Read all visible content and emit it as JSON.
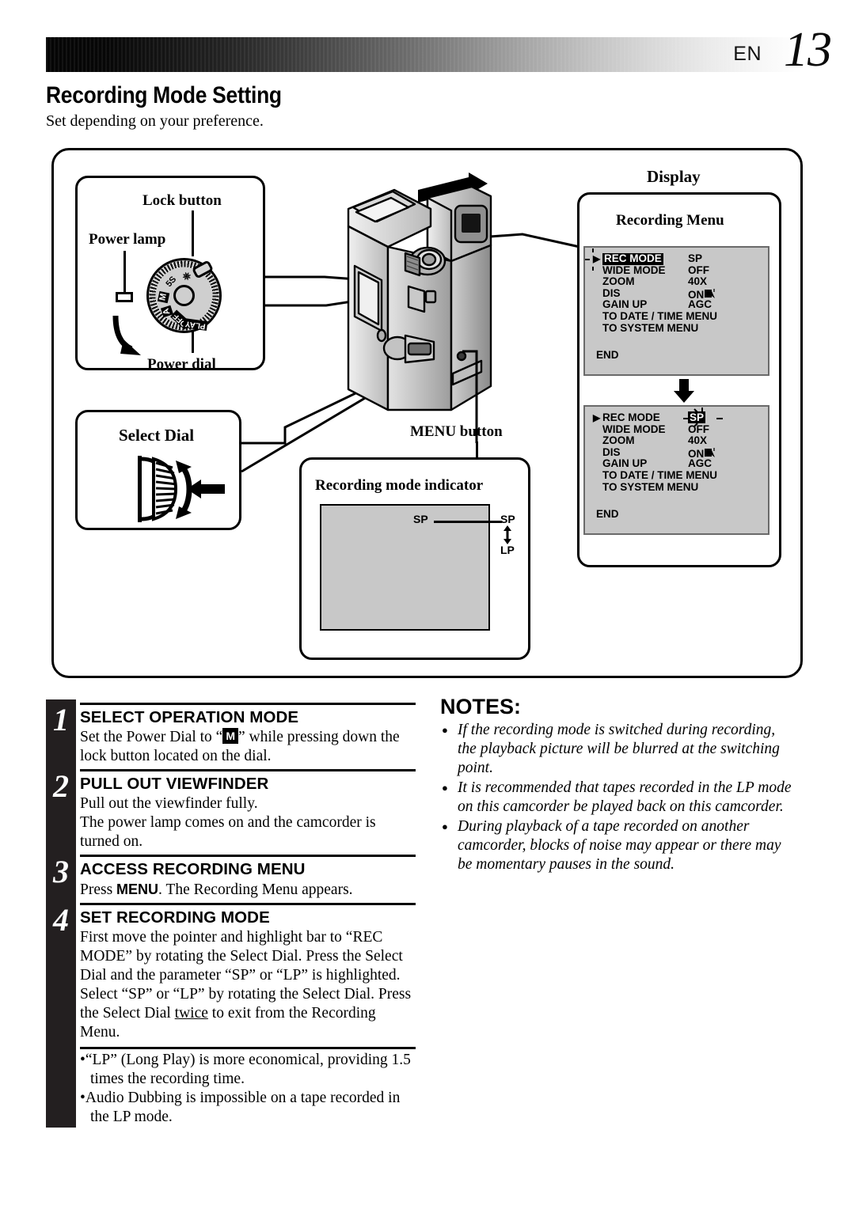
{
  "header": {
    "lang": "EN",
    "page_number": "13"
  },
  "title": "Recording Mode Setting",
  "subtitle": "Set depending on your preference.",
  "diagram": {
    "power_dial_panel": {
      "lock_button_label": "Lock button",
      "power_lamp_label": "Power lamp",
      "power_dial_label": "Power dial",
      "dial_marks": [
        "5S",
        "M",
        "A",
        "OFF",
        "PLAY"
      ]
    },
    "select_dial_panel": {
      "label": "Select Dial"
    },
    "menu_button_label": "MENU button",
    "rec_indicator_panel": {
      "title": "Recording mode indicator",
      "inside_label": "SP",
      "outside_top_label": "SP",
      "outside_bottom_label": "LP"
    },
    "display_panel": {
      "display_label": "Display",
      "recording_menu_label": "Recording Menu",
      "menu_screen_1": {
        "pointer_row": 0,
        "highlight": "name",
        "rows": [
          {
            "name": "REC MODE",
            "value": "SP"
          },
          {
            "name": "WIDE MODE",
            "value": "OFF"
          },
          {
            "name": "ZOOM",
            "value": "40X"
          },
          {
            "name": "DIS",
            "value": "ON"
          },
          {
            "name": "GAIN UP",
            "value": "AGC"
          },
          {
            "name": "TO DATE / TIME MENU",
            "value": ""
          },
          {
            "name": "TO SYSTEM MENU",
            "value": ""
          }
        ],
        "end_label": "END"
      },
      "menu_screen_2": {
        "pointer_row": 0,
        "highlight": "value",
        "rows": [
          {
            "name": "REC MODE",
            "value": "SP"
          },
          {
            "name": "WIDE MODE",
            "value": "OFF"
          },
          {
            "name": "ZOOM",
            "value": "40X"
          },
          {
            "name": "DIS",
            "value": "ON"
          },
          {
            "name": "GAIN UP",
            "value": "AGC"
          },
          {
            "name": "TO DATE / TIME MENU",
            "value": ""
          },
          {
            "name": "TO SYSTEM MENU",
            "value": ""
          }
        ],
        "end_label": "END"
      }
    }
  },
  "steps": [
    {
      "number": "1",
      "heading": "SELECT OPERATION MODE",
      "body_pre": "Set the Power Dial to “",
      "body_key": "M",
      "body_post": "” while pressing down the lock button located on the dial."
    },
    {
      "number": "2",
      "heading": "PULL OUT VIEWFINDER",
      "body": "Pull out the viewfinder fully.\nThe power lamp comes on and the camcorder is turned on."
    },
    {
      "number": "3",
      "heading": "ACCESS RECORDING MENU",
      "body_pre": "Press ",
      "body_key": "MENU",
      "body_post": ". The Recording Menu appears."
    },
    {
      "number": "4",
      "heading": "SET RECORDING MODE",
      "body_pre": "First move the pointer and highlight bar to “REC MODE” by rotating the Select Dial. Press the Select Dial and the parameter “SP” or “LP” is highlighted. Select “SP” or “LP” by rotating the Select Dial. Press the Select Dial ",
      "body_key": "twice",
      "body_post": " to exit from the Recording Menu."
    }
  ],
  "step_bullets": [
    "“LP” (Long Play) is more economical, providing 1.5 times the recording time.",
    "Audio Dubbing is impossible on a tape recorded in the LP mode."
  ],
  "notes": {
    "title": "NOTES:",
    "items": [
      "If the recording mode is switched during recording, the playback picture will be blurred at the switching point.",
      "It is recommended that tapes recorded in the LP mode on this camcorder be played back on this camcorder.",
      "During playback of a tape recorded on another camcorder, blocks of noise may appear or there may be momentary pauses in the sound."
    ]
  },
  "colors": {
    "ink": "#000000",
    "bar_black": "#231f20",
    "osd_gray": "#c8c8c8",
    "dial_gray": "#cfcfcf"
  }
}
